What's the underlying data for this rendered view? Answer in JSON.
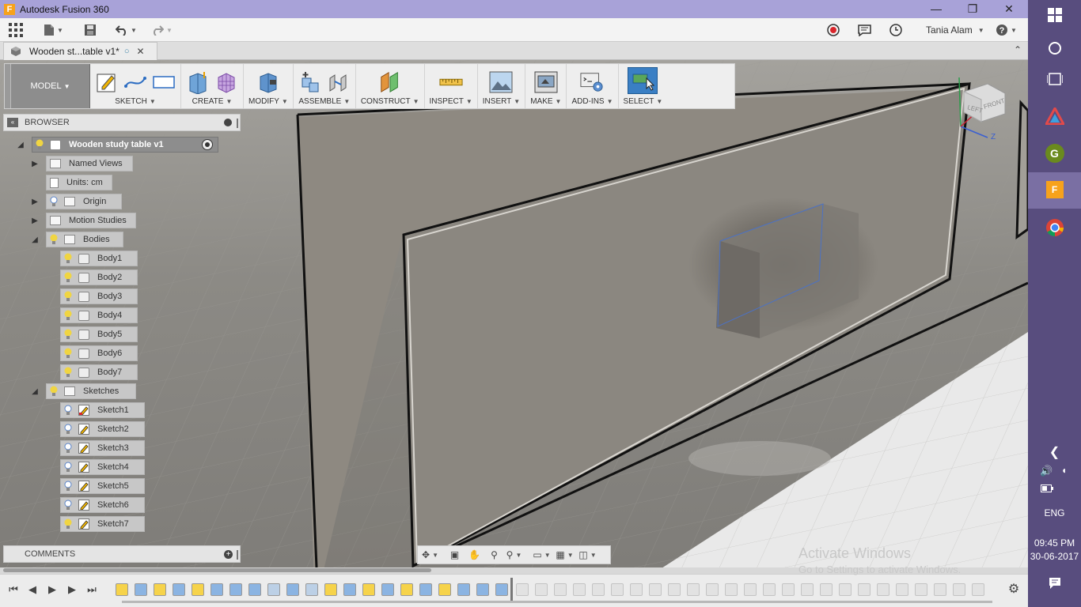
{
  "app": {
    "title": "Autodesk Fusion 360",
    "logo_letter": "F"
  },
  "quickaccess": {
    "user": "Tania Alam"
  },
  "document_tab": {
    "label": "Wooden st...table v1*"
  },
  "toolbar": {
    "workspace": "MODEL",
    "groups": [
      {
        "label": "SKETCH"
      },
      {
        "label": "CREATE"
      },
      {
        "label": "MODIFY"
      },
      {
        "label": "ASSEMBLE"
      },
      {
        "label": "CONSTRUCT"
      },
      {
        "label": "INSPECT"
      },
      {
        "label": "INSERT"
      },
      {
        "label": "MAKE"
      },
      {
        "label": "ADD-INS"
      },
      {
        "label": "SELECT"
      }
    ]
  },
  "browser": {
    "title": "BROWSER",
    "root": "Wooden study table v1",
    "named_views": "Named Views",
    "units": "Units: cm",
    "origin": "Origin",
    "motion_studies": "Motion Studies",
    "bodies": "Bodies",
    "body_items": [
      "Body1",
      "Body2",
      "Body3",
      "Body4",
      "Body5",
      "Body6",
      "Body7"
    ],
    "sketches": "Sketches",
    "sketch_items": [
      "Sketch1",
      "Sketch2",
      "Sketch3",
      "Sketch4",
      "Sketch5",
      "Sketch6",
      "Sketch7"
    ]
  },
  "comments": {
    "title": "COMMENTS"
  },
  "viewcube": {
    "left": "LEFT",
    "front": "FRONT",
    "z_axis": "Z"
  },
  "watermark": {
    "line1": "Activate Windows",
    "line2": "Go to Settings to activate Windows."
  },
  "taskbar": {
    "lang": "ENG",
    "time": "09:45 PM",
    "date": "30-06-2017",
    "app_badge": "G"
  },
  "colors": {
    "accent": "#3a7fc4",
    "titlebar": "#a8a2d8",
    "taskbar": "#584d7e"
  }
}
